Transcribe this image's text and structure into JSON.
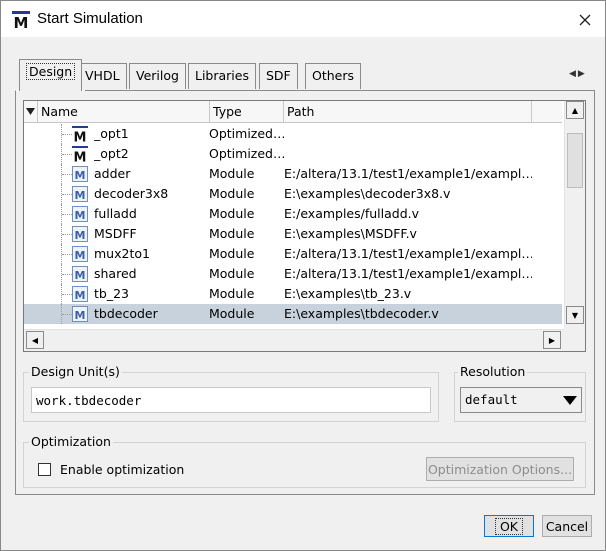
{
  "window": {
    "title": "Start Simulation",
    "app_icon": "modelsim-m-icon"
  },
  "tabs": [
    {
      "label": "Design",
      "active": true
    },
    {
      "label": "VHDL"
    },
    {
      "label": "Verilog"
    },
    {
      "label": "Libraries"
    },
    {
      "label": "SDF"
    },
    {
      "label": "Others"
    }
  ],
  "list": {
    "columns": [
      "Name",
      "Type",
      "Path"
    ],
    "rows": [
      {
        "name": "_opt1",
        "type": "Optimized…",
        "path": "",
        "icon": "optimized-icon"
      },
      {
        "name": "_opt2",
        "type": "Optimized…",
        "path": "",
        "icon": "optimized-icon"
      },
      {
        "name": "adder",
        "type": "Module",
        "path": "E:/altera/13.1/test1/example1/exampl…",
        "icon": "module-icon"
      },
      {
        "name": "decoder3x8",
        "type": "Module",
        "path": "E:\\examples\\decoder3x8.v",
        "icon": "module-icon"
      },
      {
        "name": "fulladd",
        "type": "Module",
        "path": "E:/examples/fulladd.v",
        "icon": "module-icon"
      },
      {
        "name": "MSDFF",
        "type": "Module",
        "path": "E:\\examples\\MSDFF.v",
        "icon": "module-icon"
      },
      {
        "name": "mux2to1",
        "type": "Module",
        "path": "E:/altera/13.1/test1/example1/exampl…",
        "icon": "module-icon"
      },
      {
        "name": "shared",
        "type": "Module",
        "path": "E:/altera/13.1/test1/example1/exampl…",
        "icon": "module-icon"
      },
      {
        "name": "tb_23",
        "type": "Module",
        "path": "E:\\examples\\tb_23.v",
        "icon": "module-icon"
      },
      {
        "name": "tbdecoder",
        "type": "Module",
        "path": "E:\\examples\\tbdecoder.v",
        "icon": "module-icon",
        "selected": true
      }
    ]
  },
  "design_units": {
    "label": "Design Unit(s)",
    "value": "work.tbdecoder"
  },
  "resolution": {
    "label": "Resolution",
    "value": "default"
  },
  "optimization": {
    "label": "Optimization",
    "enable_label": "Enable optimization",
    "enabled": false,
    "options_button": "Optimization Options..."
  },
  "buttons": {
    "ok": "OK",
    "cancel": "Cancel"
  },
  "colors": {
    "selection": "#c7d2dd",
    "icon_blue": "#1f3b9c",
    "background": "#f0f0f0"
  }
}
